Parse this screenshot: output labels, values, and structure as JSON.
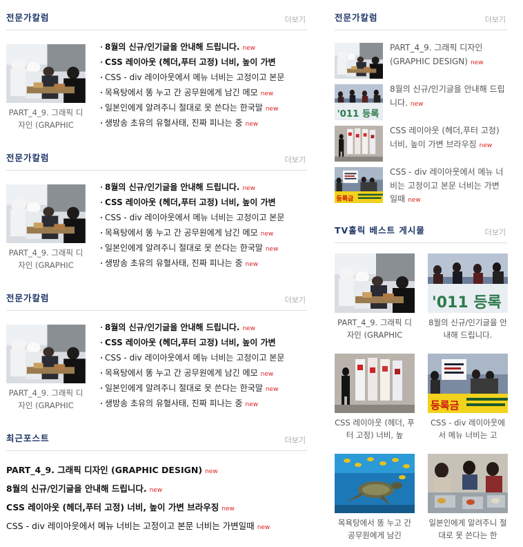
{
  "left": {
    "columns": [
      {
        "title": "전문가칼럼",
        "more": "더보기",
        "thumb_caption": "PART_4_9. 그래픽 디자인 (GRAPHIC",
        "items": [
          {
            "text": "8월의 신규/인기글을 안내해 드립니다.",
            "badge": "new",
            "bold": true
          },
          {
            "text": "CSS 레이아웃 (헤더,푸터 고정) 너비, 높이 가변",
            "badge": "",
            "bold": true
          },
          {
            "text": "CSS - div 레이아웃에서 메뉴 너비는 고정이고 본문",
            "badge": "",
            "bold": false
          },
          {
            "text": "목욕탕에서 똥 누고 간 공무원에게 남긴 메모",
            "badge": "new",
            "bold": false
          },
          {
            "text": "일본인에게 알려주니 절대로 못 쓴다는 한국말",
            "badge": "new",
            "bold": false
          },
          {
            "text": "생방송 초유의 유혈사태, 진짜 피나는 중",
            "badge": "new",
            "bold": false
          }
        ]
      },
      {
        "title": "전문가칼럼",
        "more": "더보기",
        "thumb_caption": "PART_4_9. 그래픽 디자인 (GRAPHIC",
        "items": [
          {
            "text": "8월의 신규/인기글을 안내해 드립니다.",
            "badge": "new",
            "bold": true
          },
          {
            "text": "CSS 레이아웃 (헤더,푸터 고정) 너비, 높이 가변",
            "badge": "",
            "bold": true
          },
          {
            "text": "CSS - div 레이아웃에서 메뉴 너비는 고정이고 본문",
            "badge": "",
            "bold": false
          },
          {
            "text": "목욕탕에서 똥 누고 간 공무원에게 남긴 메모",
            "badge": "new",
            "bold": false
          },
          {
            "text": "일본인에게 알려주니 절대로 못 쓴다는 한국말",
            "badge": "new",
            "bold": false
          },
          {
            "text": "생방송 초유의 유혈사태, 진짜 피나는 중",
            "badge": "new",
            "bold": false
          }
        ]
      },
      {
        "title": "전문가칼럼",
        "more": "더보기",
        "thumb_caption": "PART_4_9. 그래픽 디자인 (GRAPHIC",
        "items": [
          {
            "text": "8월의 신규/인기글을 안내해 드립니다.",
            "badge": "new",
            "bold": true
          },
          {
            "text": "CSS 레이아웃 (헤더,푸터 고정) 너비, 높이 가변",
            "badge": "",
            "bold": true
          },
          {
            "text": "CSS - div 레이아웃에서 메뉴 너비는 고정이고 본문",
            "badge": "",
            "bold": false
          },
          {
            "text": "목욕탕에서 똥 누고 간 공무원에게 남긴 메모",
            "badge": "new",
            "bold": false
          },
          {
            "text": "일본인에게 알려주니 절대로 못 쓴다는 한국말",
            "badge": "new",
            "bold": false
          },
          {
            "text": "생방송 초유의 유혈사태, 진짜 피나는 중",
            "badge": "new",
            "bold": false
          }
        ]
      }
    ],
    "recent": {
      "title": "최근포스트",
      "more": "더보기",
      "items": [
        {
          "text": "PART_4_9. 그래픽 디자인 (GRAPHIC DESIGN)",
          "badge": "new",
          "bold": true
        },
        {
          "text": "8월의 신규/인기글을 안내해 드립니다.",
          "badge": "new",
          "bold": true
        },
        {
          "text": "CSS 레이아웃 (헤더,푸터 고정) 너비, 높이 가변 브라우징",
          "badge": "new",
          "bold": true
        },
        {
          "text": "CSS - div 레이아웃에서 메뉴 너비는 고정이고 본문 너비는 가변일때",
          "badge": "new",
          "bold": false
        }
      ]
    }
  },
  "right": {
    "column": {
      "title": "전문가칼럼",
      "more": "더보기",
      "items": [
        {
          "text": "PART_4_9. 그래픽 디자인 (GRAPHIC DESIGN)",
          "badge": "new"
        },
        {
          "text": "8월의 신규/인기글을 안내해 드립니다.",
          "badge": "new"
        },
        {
          "text": "CSS 레이아웃 (헤더,푸터 고정) 너비, 높이 가변 브라우징",
          "badge": "new"
        },
        {
          "text": "CSS - div 레이아웃에서 메뉴 너비는 고정이고 본문 너비는 가변일때",
          "badge": "new"
        }
      ]
    },
    "tv": {
      "title": "TV홀릭 베스트 게시물",
      "more": "더보기",
      "items": [
        {
          "caption": "PART_4_9. 그래픽 디자인 (GRAPHIC"
        },
        {
          "caption": "8월의 신규/인기글을 안내해 드립니다."
        },
        {
          "caption": "CSS 레이아웃 (헤더, 푸터 고정) 너비, 높"
        },
        {
          "caption": "CSS - div 레이아웃에서 메뉴 너비는 고"
        },
        {
          "caption": "목욕탕에서 똥 누고 간 공무원에게 남긴"
        },
        {
          "caption": "일본인에게 알려주니 절대로 못 쓴다는 한"
        }
      ]
    }
  },
  "colors": {
    "title": "#1e3566",
    "badge": "#dd2222",
    "divider": "#dddddd",
    "more": "#aaaaaa"
  },
  "image_names": [
    "kitchen-workers-photo",
    "protest-banner-photo",
    "poster-street-photo",
    "rally-sign-photo",
    "sea-turtle-photo",
    "children-lunch-photo"
  ]
}
